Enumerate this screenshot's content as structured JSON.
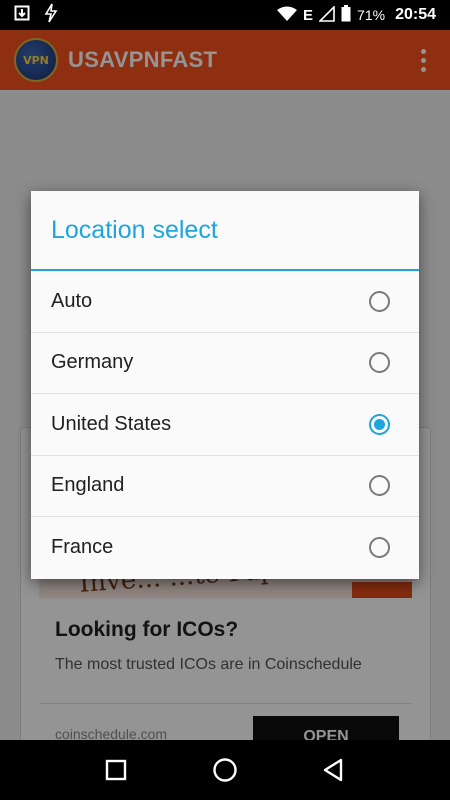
{
  "status_bar": {
    "network_type": "E",
    "battery_percent": "71%",
    "time": "20:54",
    "icons": [
      "screenshot-icon",
      "flash-icon",
      "wifi-icon",
      "signal-icon",
      "battery-icon"
    ]
  },
  "app_bar": {
    "logo_text": "VPN",
    "title": "USAVPNFAST",
    "menu_icon": "overflow-menu-icon"
  },
  "ad": {
    "banner_text": "Inve... ...te Pap",
    "title": "Looking for ICOs?",
    "subtitle": "The most trusted ICOs are in Coinschedule",
    "domain": "coinschedule.com",
    "button_label": "OPEN"
  },
  "dialog": {
    "title": "Location select",
    "options": [
      {
        "label": "Auto",
        "selected": false
      },
      {
        "label": "Germany",
        "selected": false
      },
      {
        "label": "United States",
        "selected": true
      },
      {
        "label": "England",
        "selected": false
      },
      {
        "label": "France",
        "selected": false
      }
    ],
    "accent_color": "#1ea5de"
  },
  "nav_bar": {
    "recents_icon": "square-recents-icon",
    "home_icon": "circle-home-icon",
    "back_icon": "triangle-back-icon"
  },
  "colors": {
    "app_bar": "#f4511e",
    "accent": "#1ea5de"
  }
}
